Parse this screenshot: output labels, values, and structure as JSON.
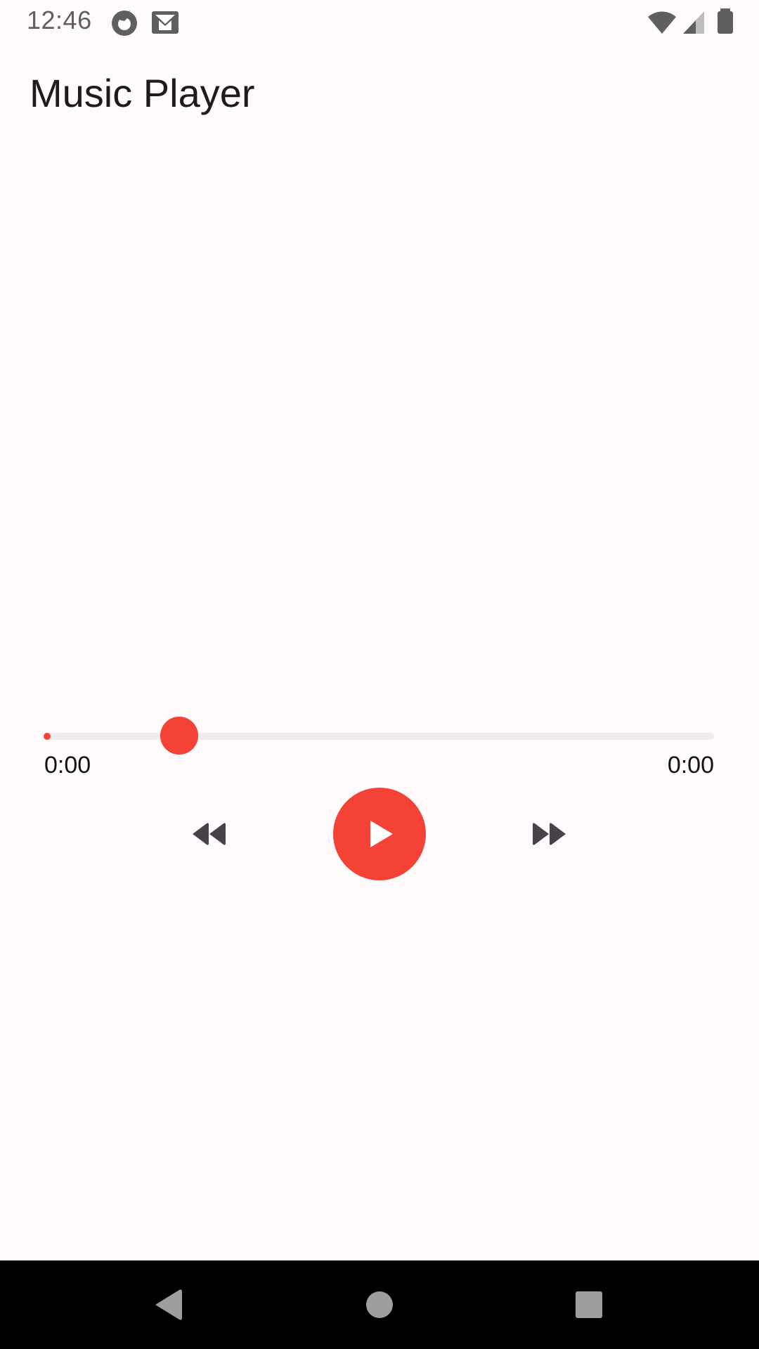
{
  "status_bar": {
    "time": "12:46",
    "left_icons": [
      "firefox-icon",
      "gmail-icon"
    ],
    "right_icons": [
      "wifi-icon",
      "signal-icon",
      "battery-icon"
    ]
  },
  "app_bar": {
    "title": "Music Player"
  },
  "player": {
    "progress_fraction": 0.0,
    "thumb_fraction": 0.2,
    "current_time": "0:00",
    "total_time": "0:00",
    "state": "paused",
    "controls": [
      "rewind-icon",
      "play-icon",
      "fast-forward-icon"
    ]
  },
  "nav_bar": {
    "items": [
      "back-icon",
      "home-icon",
      "recents-icon"
    ]
  },
  "colors": {
    "accent": "#f44336",
    "background": "#fffbfd",
    "track": "#efecee",
    "icon_dark": "#45424a",
    "nav_icon": "#9e9e9e"
  }
}
